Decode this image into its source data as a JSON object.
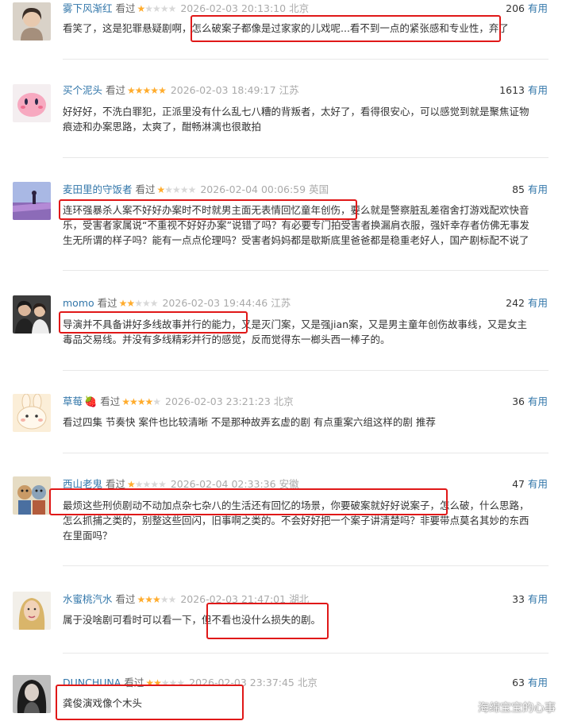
{
  "reviews": [
    {
      "user": "雾下风渐红",
      "watched": "看过",
      "rating": 1,
      "time": "2026-02-03 20:13:10",
      "location": "北京",
      "votes": "206",
      "useful_label": "有用",
      "lines": [
        "看笑了，这是犯罪悬疑剧啊，怎么破案子都像是过家家的儿戏呢...看不到一点的紧张感和专业性，弃了"
      ]
    },
    {
      "user": "买个泥头",
      "watched": "看过",
      "rating": 5,
      "time": "2026-02-03 18:49:17",
      "location": "江苏",
      "votes": "1613",
      "useful_label": "有用",
      "lines": [
        "好好好，不洗白罪犯，正派里没有什么乱七八糟的背叛者，太好了，看得很安心，可以感觉到就是聚焦证物",
        "痕迹和办案思路，太爽了，酣畅淋漓也很敢拍"
      ]
    },
    {
      "user": "麦田里的守饭者",
      "watched": "看过",
      "rating": 1,
      "time": "2026-02-04 00:06:59",
      "location": "英国",
      "votes": "85",
      "useful_label": "有用",
      "lines": [
        "连环强暴杀人案不好好办案时不时就男主面无表情回忆童年创伤，要么就是警察脏乱差宿舍打游戏配欢快音",
        "乐，受害者家属说“不重视不好好办案”说错了吗？有必要专门拍受害者换漏肩衣服，强奸幸存者仿佛无事发",
        "生无所谓的样子吗？能有一点点伦理吗？受害者妈妈都是歇斯底里爸爸都是稳重老好人，国产剧标配不说了"
      ]
    },
    {
      "user": "momo",
      "watched": "看过",
      "rating": 2,
      "time": "2026-02-03 19:44:46",
      "location": "江苏",
      "votes": "242",
      "useful_label": "有用",
      "lines": [
        "导演并不具备讲好多线故事并行的能力，又是灭门案，又是强jian案，又是男主童年创伤故事线，又是女主",
        "毒品交易线。并没有多线精彩并行的感觉，反而觉得东一榔头西一棒子的。"
      ]
    },
    {
      "user": "草莓",
      "watched": "看过",
      "rating": 4,
      "time": "2026-02-03 23:21:23",
      "location": "北京",
      "votes": "36",
      "useful_label": "有用",
      "lines": [
        "看过四集 节奏快 案件也比较清晰 不是那种故弄玄虚的剧 有点重案六组这样的剧 推荐"
      ]
    },
    {
      "user": "西山老鬼",
      "watched": "看过",
      "rating": 1,
      "time": "2026-02-04 02:33:36",
      "location": "安徽",
      "votes": "47",
      "useful_label": "有用",
      "lines": [
        "最烦这些刑侦剧动不动加点杂七杂八的生活还有回忆的场景，你要破案就好好说案子，怎么破，什么思路，",
        "怎么抓捕之类的，别整这些回闪，旧事啊之类的。不会好好把一个案子讲清楚吗？非要带点莫名其妙的东西",
        "在里面吗？"
      ]
    },
    {
      "user": "水蜜桃汽水",
      "watched": "看过",
      "rating": 3,
      "time": "2026-02-03 21:47:01",
      "location": "湖北",
      "votes": "33",
      "useful_label": "有用",
      "lines": [
        "属于没啥剧可看时可以看一下，但不看也没什么损失的剧。"
      ]
    },
    {
      "user": "DUNCHUNA",
      "watched": "看过",
      "rating": 2,
      "time": "2026-02-03 23:37:45",
      "location": "北京",
      "votes": "63",
      "useful_label": "有用",
      "lines": [
        "龚俊演戏像个木头"
      ]
    }
  ],
  "watermark": "海绵宝宝的心事",
  "colors": {
    "link": "#3377aa",
    "star": "#ffac2d",
    "star_empty": "#d8d8d8",
    "highlight": "#e01818"
  }
}
